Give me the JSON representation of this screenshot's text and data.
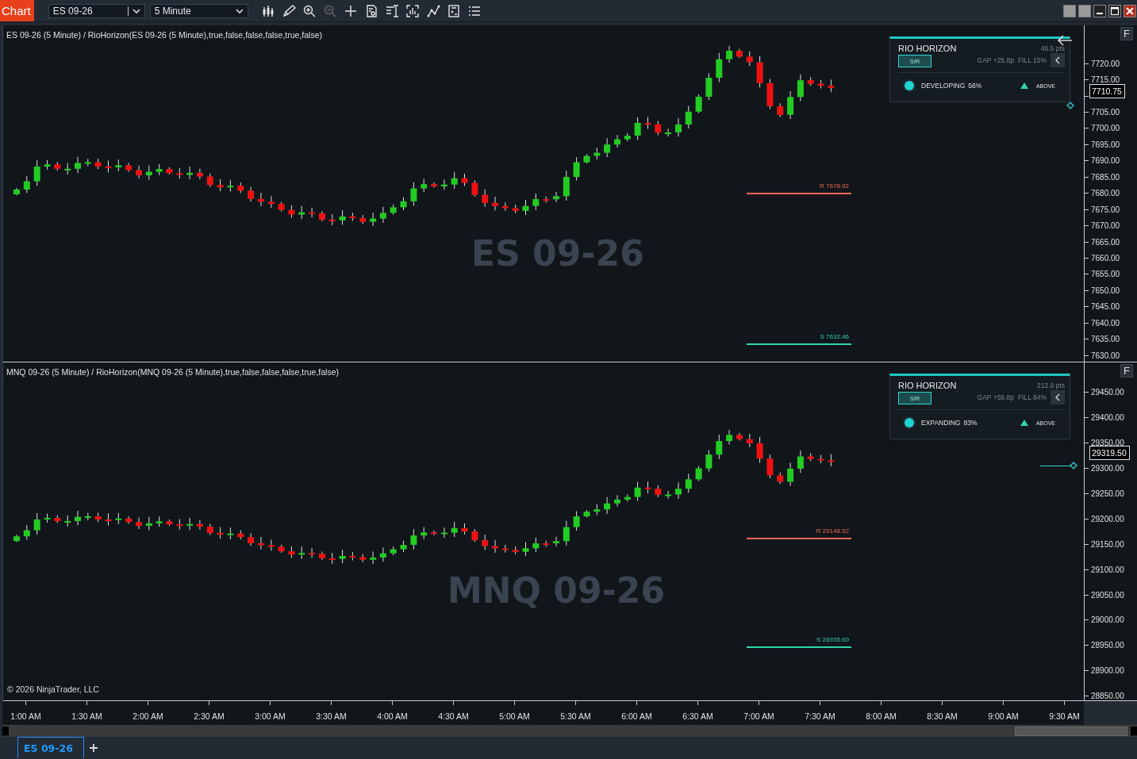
{
  "toolbar": {
    "app_label": "Chart",
    "instrument": "ES 09-26",
    "interval": "5 Minute"
  },
  "panels": [
    {
      "title": "ES 09-26 (5 Minute) / RioHorizon(ES 09-26 (5 Minute),true,false,false,false,true,false)",
      "watermark": "ES 09-26",
      "f_button": "F",
      "current_price": "7710.75",
      "price_labels": [
        "7720.00",
        "7715.00",
        "7705.00",
        "7700.00",
        "7695.00",
        "7690.00",
        "7685.00",
        "7680.00",
        "7675.00",
        "7670.00",
        "7665.00",
        "7660.00",
        "7655.00",
        "7650.00",
        "7645.00",
        "7640.00",
        "7635.00",
        "7630.00"
      ],
      "widget": {
        "title": "RIO HORIZON",
        "points": "46.5 pts",
        "mode_button": "S/R",
        "gap": "GAP +25.8p",
        "fill": "FILL 15%",
        "state": "DEVELOPING",
        "state_pct": "56%",
        "direction": "ABOVE"
      },
      "levels": [
        {
          "kind": "resistance",
          "label": "R 7678.92"
        },
        {
          "kind": "support",
          "label": "S 7632.46"
        }
      ]
    },
    {
      "title": "MNQ 09-26 (5 Minute) / RioHorizon(MNQ 09-26 (5 Minute),true,false,false,false,true,false)",
      "watermark": "MNQ 09-26",
      "f_button": "F",
      "current_price": "29319.50",
      "price_labels": [
        "29450.00",
        "29400.00",
        "29350.00",
        "29300.00",
        "29250.00",
        "29200.00",
        "29150.00",
        "29100.00",
        "29050.00",
        "29000.00",
        "28950.00",
        "28900.00",
        "28850.00"
      ],
      "widget": {
        "title": "RIO HORIZON",
        "points": "212.9 pts",
        "mode_button": "S/R",
        "gap": "GAP +59.8p",
        "fill": "FILL 84%",
        "state": "EXPANDING",
        "state_pct": "83%",
        "direction": "ABOVE"
      },
      "levels": [
        {
          "kind": "resistance",
          "label": "R 29148.52"
        },
        {
          "kind": "support",
          "label": "S 28935.60"
        }
      ]
    }
  ],
  "copyright": "© 2026 NinjaTrader, LLC",
  "time_axis": [
    "1:00 AM",
    "1:30 AM",
    "2:00 AM",
    "2:30 AM",
    "3:00 AM",
    "3:30 AM",
    "4:00 AM",
    "4:30 AM",
    "5:00 AM",
    "5:30 AM",
    "6:00 AM",
    "6:30 AM",
    "7:00 AM",
    "7:30 AM",
    "8:00 AM",
    "8:30 AM",
    "9:00 AM",
    "9:30 AM"
  ],
  "tabs": [
    {
      "label": "ES 09-26",
      "selected": true
    }
  ]
}
